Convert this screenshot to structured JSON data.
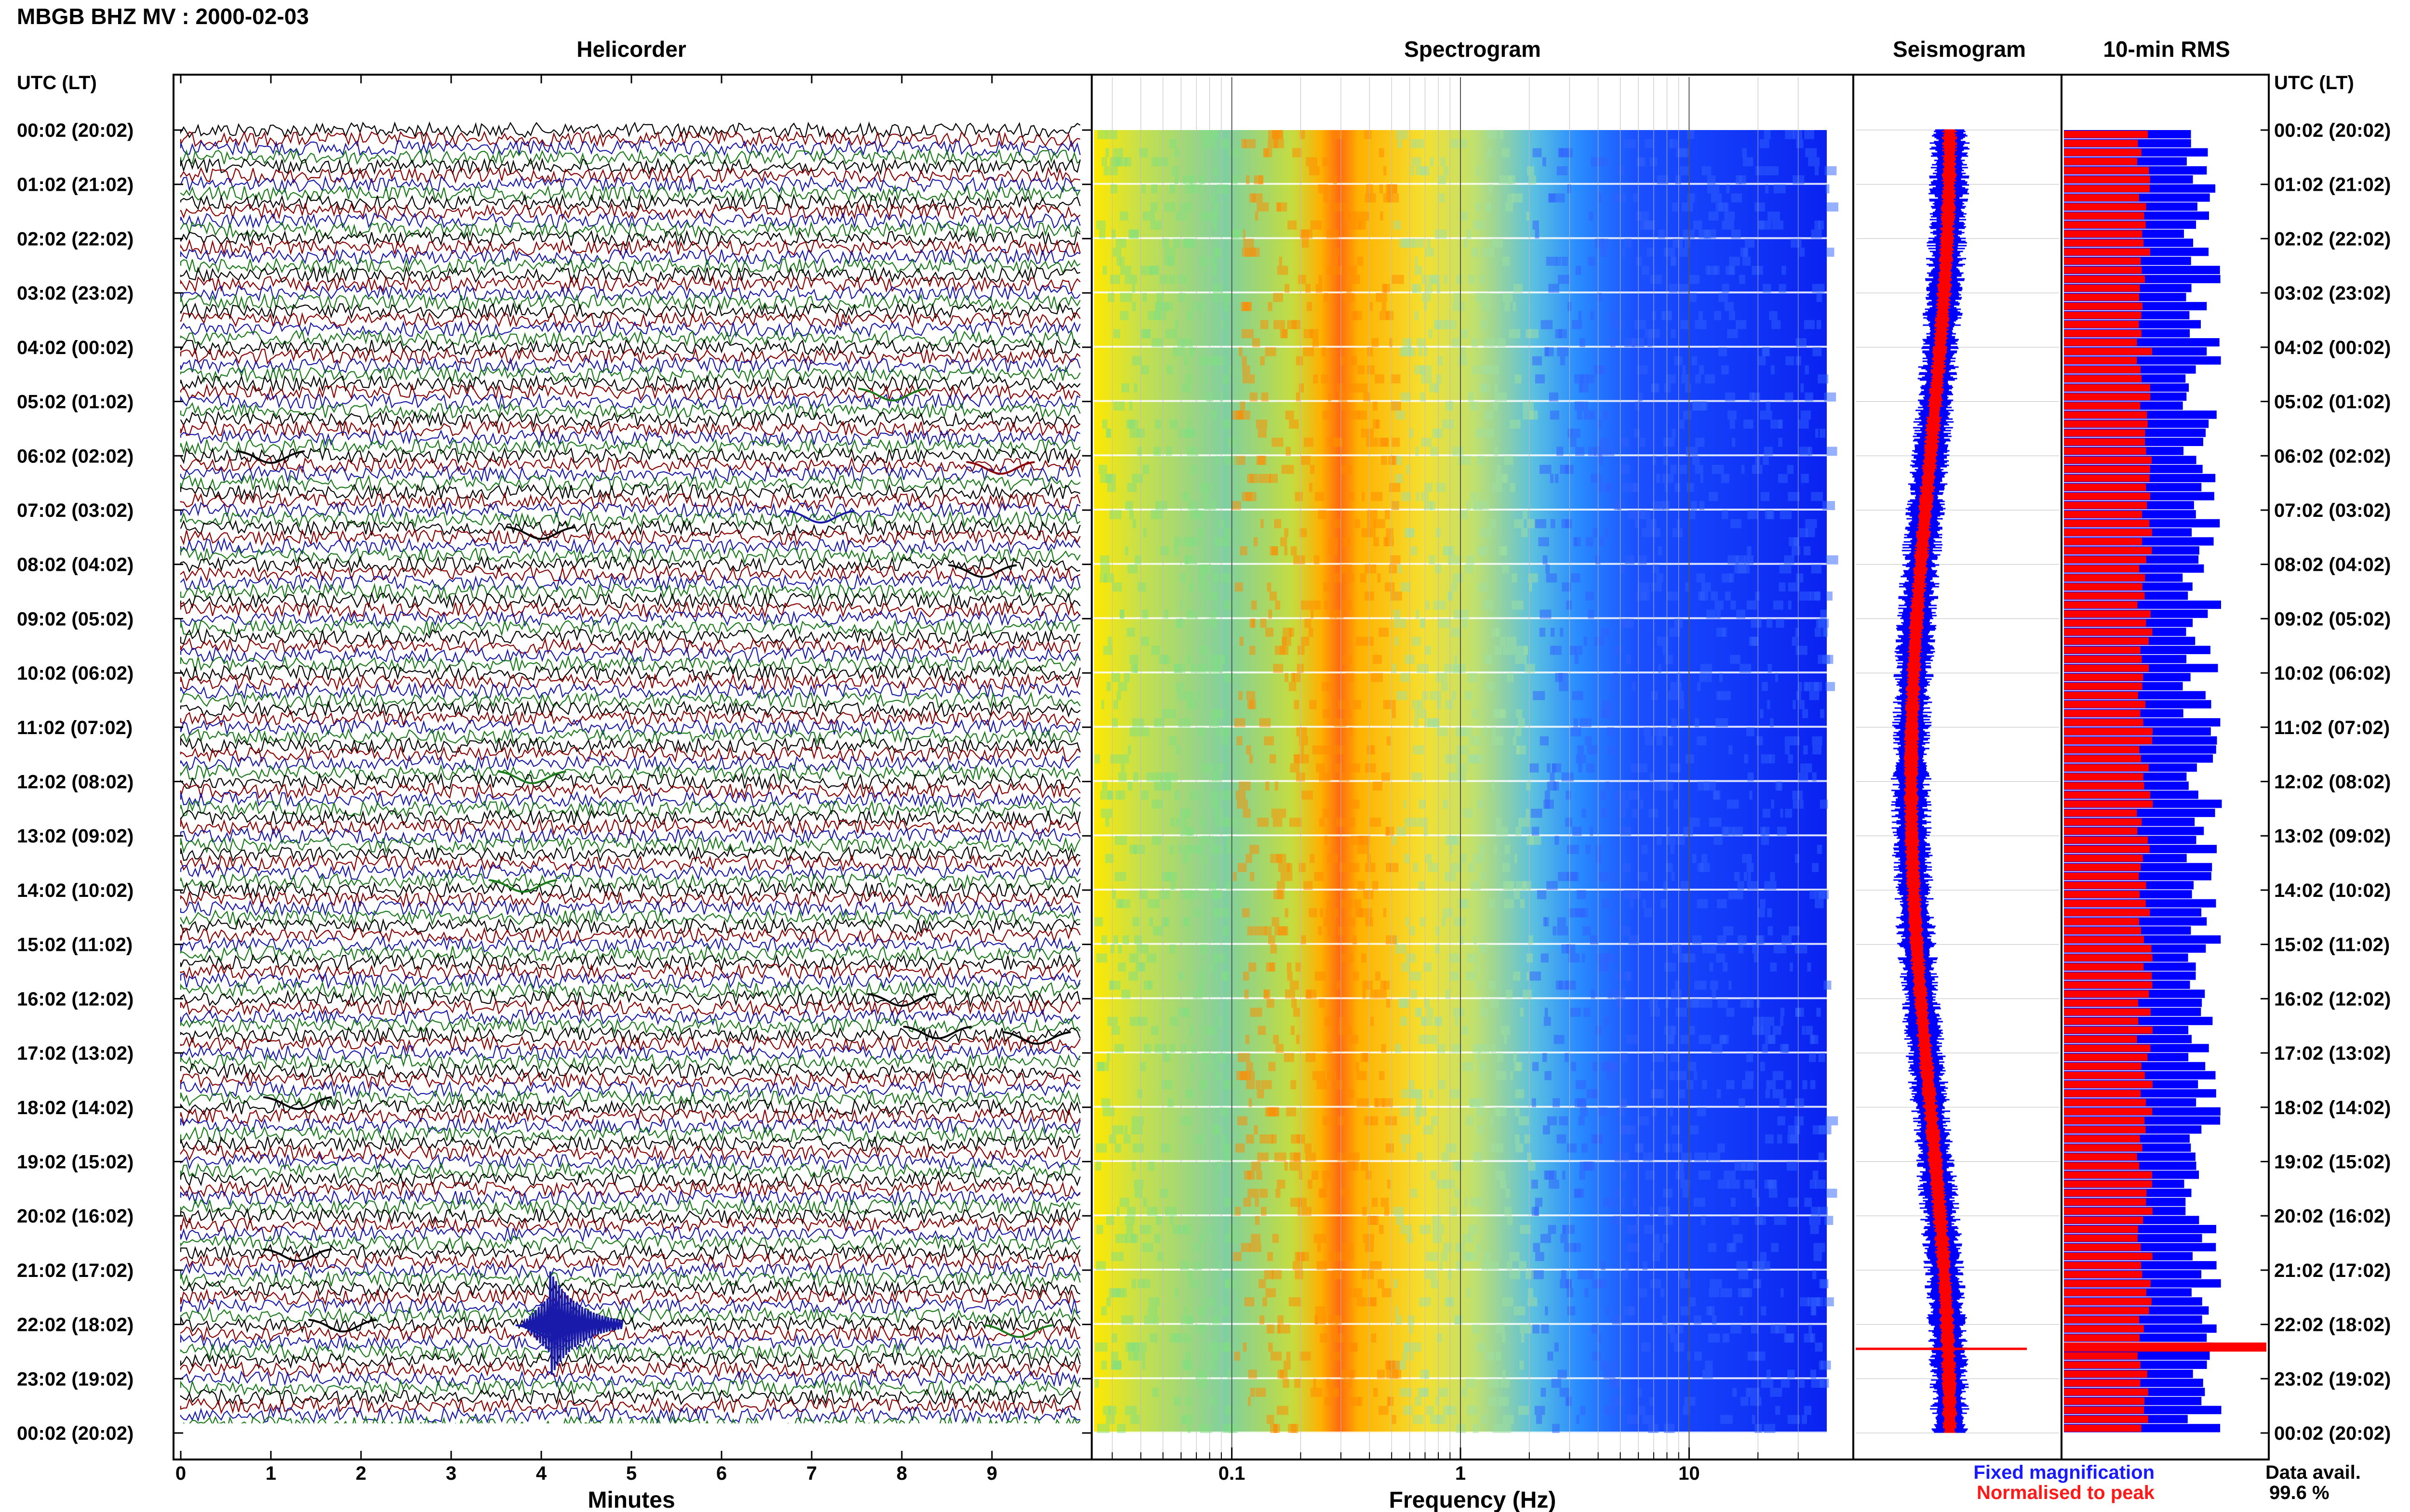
{
  "title": "MBGB BHZ MV : 2000-02-03",
  "panels": {
    "helicorder": "Helicorder",
    "spectrogram": "Spectrogram",
    "seismogram": "Seismogram",
    "rms": "10-min RMS"
  },
  "axis_labels": {
    "left_time_header": "UTC (LT)",
    "right_time_header": "UTC (LT)",
    "helicorder_x": "Minutes",
    "spectrogram_x": "Frequency (Hz)"
  },
  "legend": {
    "fixed": "Fixed magnification",
    "normalised": "Normalised to peak",
    "fixed_color": "#1a1aff",
    "normalised_color": "#ff1a1a"
  },
  "data_availability": {
    "label": "Data avail.",
    "value": "99.6 %"
  },
  "colors": {
    "trace_cycle": [
      "#000000",
      "#8b0000",
      "#1a1aaa",
      "#1a7a1a"
    ],
    "seismo_fixed": "#0000ff",
    "seismo_norm": "#ff0000",
    "rms_fixed": "#0000ff",
    "rms_norm": "#ff0000",
    "spectro_low": "#ffe000",
    "spectro_peak": "#ff5a00",
    "spectro_high": "#0a2aff"
  },
  "chart_data": [
    {
      "type": "line",
      "title": "Helicorder",
      "xlabel": "Minutes",
      "xlim": [
        0,
        10
      ],
      "xticks": [
        "0",
        "1",
        "2",
        "3",
        "4",
        "5",
        "6",
        "7",
        "8",
        "9"
      ],
      "time_labels": [
        "00:02 (20:02)",
        "01:02 (21:02)",
        "02:02 (22:02)",
        "03:02 (23:02)",
        "04:02 (00:02)",
        "05:02 (01:02)",
        "06:02 (02:02)",
        "07:02 (03:02)",
        "08:02 (04:02)",
        "09:02 (05:02)",
        "10:02 (06:02)",
        "11:02 (07:02)",
        "12:02 (08:02)",
        "13:02 (09:02)",
        "14:02 (10:02)",
        "15:02 (11:02)",
        "16:02 (12:02)",
        "17:02 (13:02)",
        "18:02 (14:02)",
        "19:02 (15:02)",
        "20:02 (16:02)",
        "21:02 (17:02)",
        "22:02 (18:02)",
        "23:02 (19:02)",
        "00:02 (20:02)"
      ],
      "rows_per_hour": 6,
      "events": [
        {
          "hour": 4.75,
          "minute": 7.9,
          "color": "#1a7a1a"
        },
        {
          "hour": 5.9,
          "minute": 1.0,
          "color": "#000000"
        },
        {
          "hour": 6.1,
          "minute": 9.1,
          "color": "#8b0000"
        },
        {
          "hour": 7.3,
          "minute": 4.0,
          "color": "#000000"
        },
        {
          "hour": 7.0,
          "minute": 7.1,
          "color": "#1a1aaa"
        },
        {
          "hour": 8.0,
          "minute": 8.9,
          "color": "#000000"
        },
        {
          "hour": 11.8,
          "minute": 3.9,
          "color": "#1a7a1a"
        },
        {
          "hour": 13.8,
          "minute": 3.8,
          "color": "#1a7a1a"
        },
        {
          "hour": 15.9,
          "minute": 8.0,
          "color": "#000000"
        },
        {
          "hour": 16.5,
          "minute": 8.4,
          "color": "#000000"
        },
        {
          "hour": 16.6,
          "minute": 9.5,
          "color": "#000000"
        },
        {
          "hour": 17.8,
          "minute": 1.3,
          "color": "#000000"
        },
        {
          "hour": 20.6,
          "minute": 1.3,
          "color": "#000000"
        },
        {
          "hour": 21.9,
          "minute": 1.8,
          "color": "#000000"
        },
        {
          "hour": 22.0,
          "minute": 4.1,
          "color": "#1a1aaa"
        },
        {
          "hour": 22.0,
          "minute": 9.3,
          "color": "#1a7a1a"
        }
      ]
    },
    {
      "type": "heatmap",
      "title": "Spectrogram",
      "xlabel": "Frequency (Hz)",
      "xscale": "log",
      "xlim": [
        0.025,
        40
      ],
      "xticks": [
        0.1,
        1,
        10
      ],
      "xtick_labels": [
        "0.1",
        "1",
        "10"
      ],
      "peak_frequency_hz": 0.25,
      "energy_falloff_hz": 2.5
    },
    {
      "type": "line",
      "title": "Seismogram",
      "series": [
        {
          "name": "Fixed magnification",
          "color": "#0000ff"
        },
        {
          "name": "Normalised to peak",
          "color": "#ff0000"
        }
      ]
    },
    {
      "type": "bar",
      "title": "10-min RMS",
      "note": "24 hourly blocks of 6 ten-minute bars",
      "fixed_level_range": [
        0.75,
        1.0
      ],
      "normalised_level": 0.4
    }
  ]
}
